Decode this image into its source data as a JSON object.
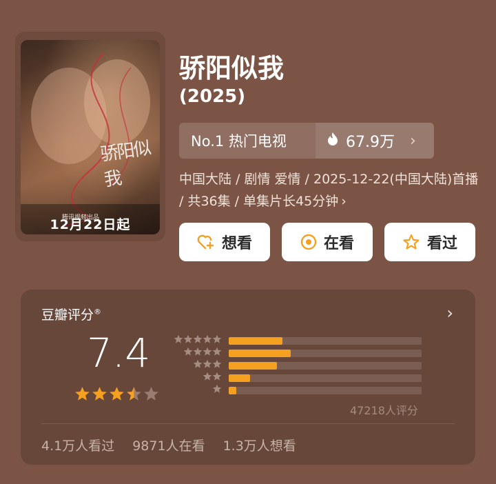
{
  "poster": {
    "calligraphy": "骄阳似我",
    "tagline": "腾讯视频出品",
    "date_text": "12月22日起"
  },
  "title": "骄阳似我",
  "year": "(2025)",
  "rank": {
    "label": "No.1 热门电视",
    "heat": "67.9万"
  },
  "meta": {
    "line": "中国大陆 / 剧情 爱情 / 2025-12-22(中国大陆)首播 / 共36集 / 单集片长45分钟"
  },
  "actions": {
    "want": "想看",
    "watching": "在看",
    "watched": "看过"
  },
  "rating": {
    "source": "豆瓣评分",
    "registered": "®",
    "score": "7.4",
    "stars": 3.5,
    "distribution": [
      {
        "stars": 5,
        "fraction": 0.28
      },
      {
        "stars": 4,
        "fraction": 0.32
      },
      {
        "stars": 3,
        "fraction": 0.25
      },
      {
        "stars": 2,
        "fraction": 0.11
      },
      {
        "stars": 1,
        "fraction": 0.04
      }
    ],
    "count_text": "47218人评分"
  },
  "stats": {
    "watched": "4.1万人看过",
    "watching": "9871人在看",
    "want": "1.3万人想看"
  },
  "colors": {
    "background": "#7b5445",
    "card": "#67473a",
    "accent": "#f5a021",
    "button": "#ffffff"
  },
  "icons": {
    "heat": "flame-icon",
    "want": "heart-plus-icon",
    "watching": "target-circle-icon",
    "watched": "star-outline-icon"
  }
}
